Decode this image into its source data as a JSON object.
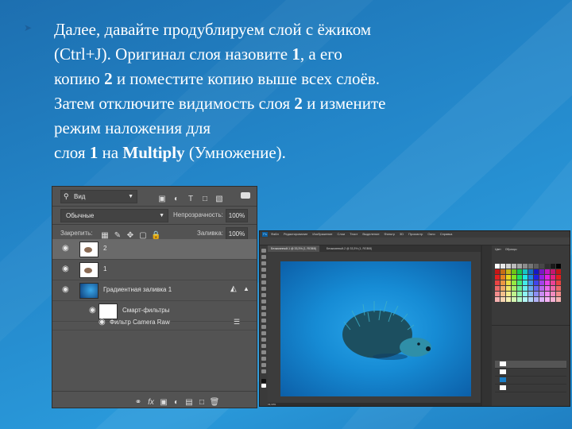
{
  "slide": {
    "line1": "Далее, давайте продублируем слой с ёжиком",
    "line2_a": "(Ctrl+J). Оригинал слоя назовите ",
    "line2_b": "1",
    "line2_c": ", а его",
    "line3_a": "копию ",
    "line3_b": "2",
    "line3_c": " и поместите копию выше всех слоёв.",
    "line4_a": "Затем отключите видимость слоя ",
    "line4_b": "2",
    "line4_c": " и измените",
    "line5": "режим наложения для",
    "line6_a": "слоя ",
    "line6_b": "1",
    "line6_c": " на ",
    "line6_d": "Multiply",
    "line6_e": " (Умножение).",
    "bullet_icon": "arrow-bullet-icon"
  },
  "layers_panel": {
    "search_placeholder": "Вид",
    "blend_mode": "Обычные",
    "opacity_label": "Непрозрачность:",
    "opacity_value": "100%",
    "lock_label": "Закрепить:",
    "fill_label": "Заливка:",
    "fill_value": "100%",
    "layers": [
      {
        "name": "2",
        "selected": true
      },
      {
        "name": "1",
        "selected": false
      },
      {
        "name": "Градиентная заливка 1",
        "selected": false
      },
      {
        "name": "Смарт-фильтры",
        "selected": false
      },
      {
        "name": "Фильтр Camera Raw",
        "selected": false
      }
    ]
  },
  "ps_window": {
    "logo": "Ps",
    "menu": [
      "Файл",
      "Редактирование",
      "Изображение",
      "Слои",
      "Текст",
      "Выделение",
      "Фильтр",
      "3D",
      "Просмотр",
      "Окно",
      "Справка"
    ],
    "tabs": [
      "Безымянный-1 @ 33,3% (1, RGB/8)",
      "Безымянный-2 @ 33,3% (1, RGB/8)"
    ],
    "panel_tabs": [
      "Цвет",
      "Образцы"
    ],
    "status": "33,33%",
    "colors": {
      "canvas_center": "#2aa6ea",
      "canvas_edge": "#0c5fa8",
      "ui_dark": "#2b2b2b"
    }
  }
}
